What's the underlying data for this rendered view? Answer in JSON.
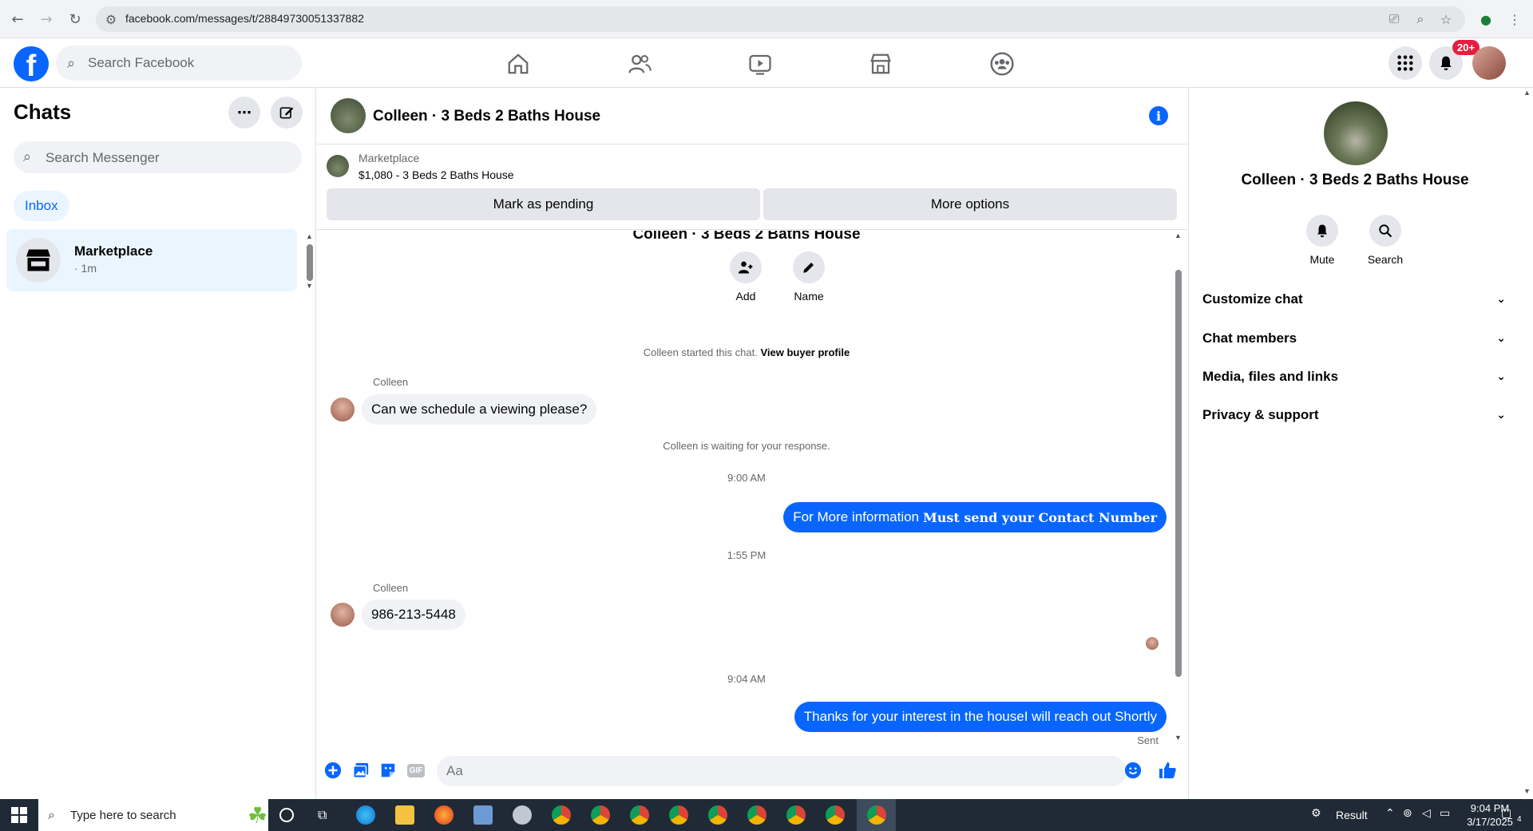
{
  "browser": {
    "url": "facebook.com/messages/t/28849730051337882"
  },
  "fb_nav": {
    "logo_letter": "f",
    "search_placeholder": "Search Facebook",
    "notification_badge": "20+"
  },
  "sidebar": {
    "title": "Chats",
    "search_placeholder": "Search Messenger",
    "filter_label": "Inbox",
    "chats": [
      {
        "name": "Marketplace",
        "time": "· 1m"
      }
    ]
  },
  "conversation": {
    "title": "Colleen · 3 Beds 2 Baths House",
    "marketplace_label": "Marketplace",
    "listing": "$1,080 - 3 Beds 2 Baths House",
    "mark_pending_label": "Mark as pending",
    "more_options_label": "More options",
    "intro_name": "Colleen · 3 Beds 2 Baths House",
    "add_label": "Add",
    "name_label": "Name",
    "started_text": "Colleen started this chat.",
    "view_profile_label": "View buyer profile",
    "waiting_text": "Colleen is waiting for your response.",
    "messages": [
      {
        "sender": "Colleen",
        "text": "Can we schedule a viewing please?"
      },
      {
        "time": "9:00 AM"
      },
      {
        "text_plain": "For More information",
        "text_bold": "Must send your Contact Number"
      },
      {
        "time": "1:55 PM"
      },
      {
        "sender": "Colleen",
        "text": "986-213-5448"
      },
      {
        "time": "9:04 AM"
      },
      {
        "text": "Thanks for your interest in the houseI will reach out Shortly"
      }
    ],
    "sent_label": "Sent",
    "composer_placeholder": "Aa",
    "gif_label": "GIF"
  },
  "right_panel": {
    "name": "Colleen · 3 Beds 2 Baths House",
    "mute_label": "Mute",
    "search_label": "Search",
    "sections": [
      "Customize chat",
      "Chat members",
      "Media, files and links",
      "Privacy & support"
    ]
  },
  "taskbar": {
    "search_placeholder": "Type here to search",
    "result_label": "Result",
    "time": "9:04 PM",
    "date": "3/17/2025",
    "notification_count": "4"
  },
  "colors": {
    "accent": "#0866ff",
    "bubble_in": "#f0f2f5",
    "badge": "#e41e3f"
  }
}
